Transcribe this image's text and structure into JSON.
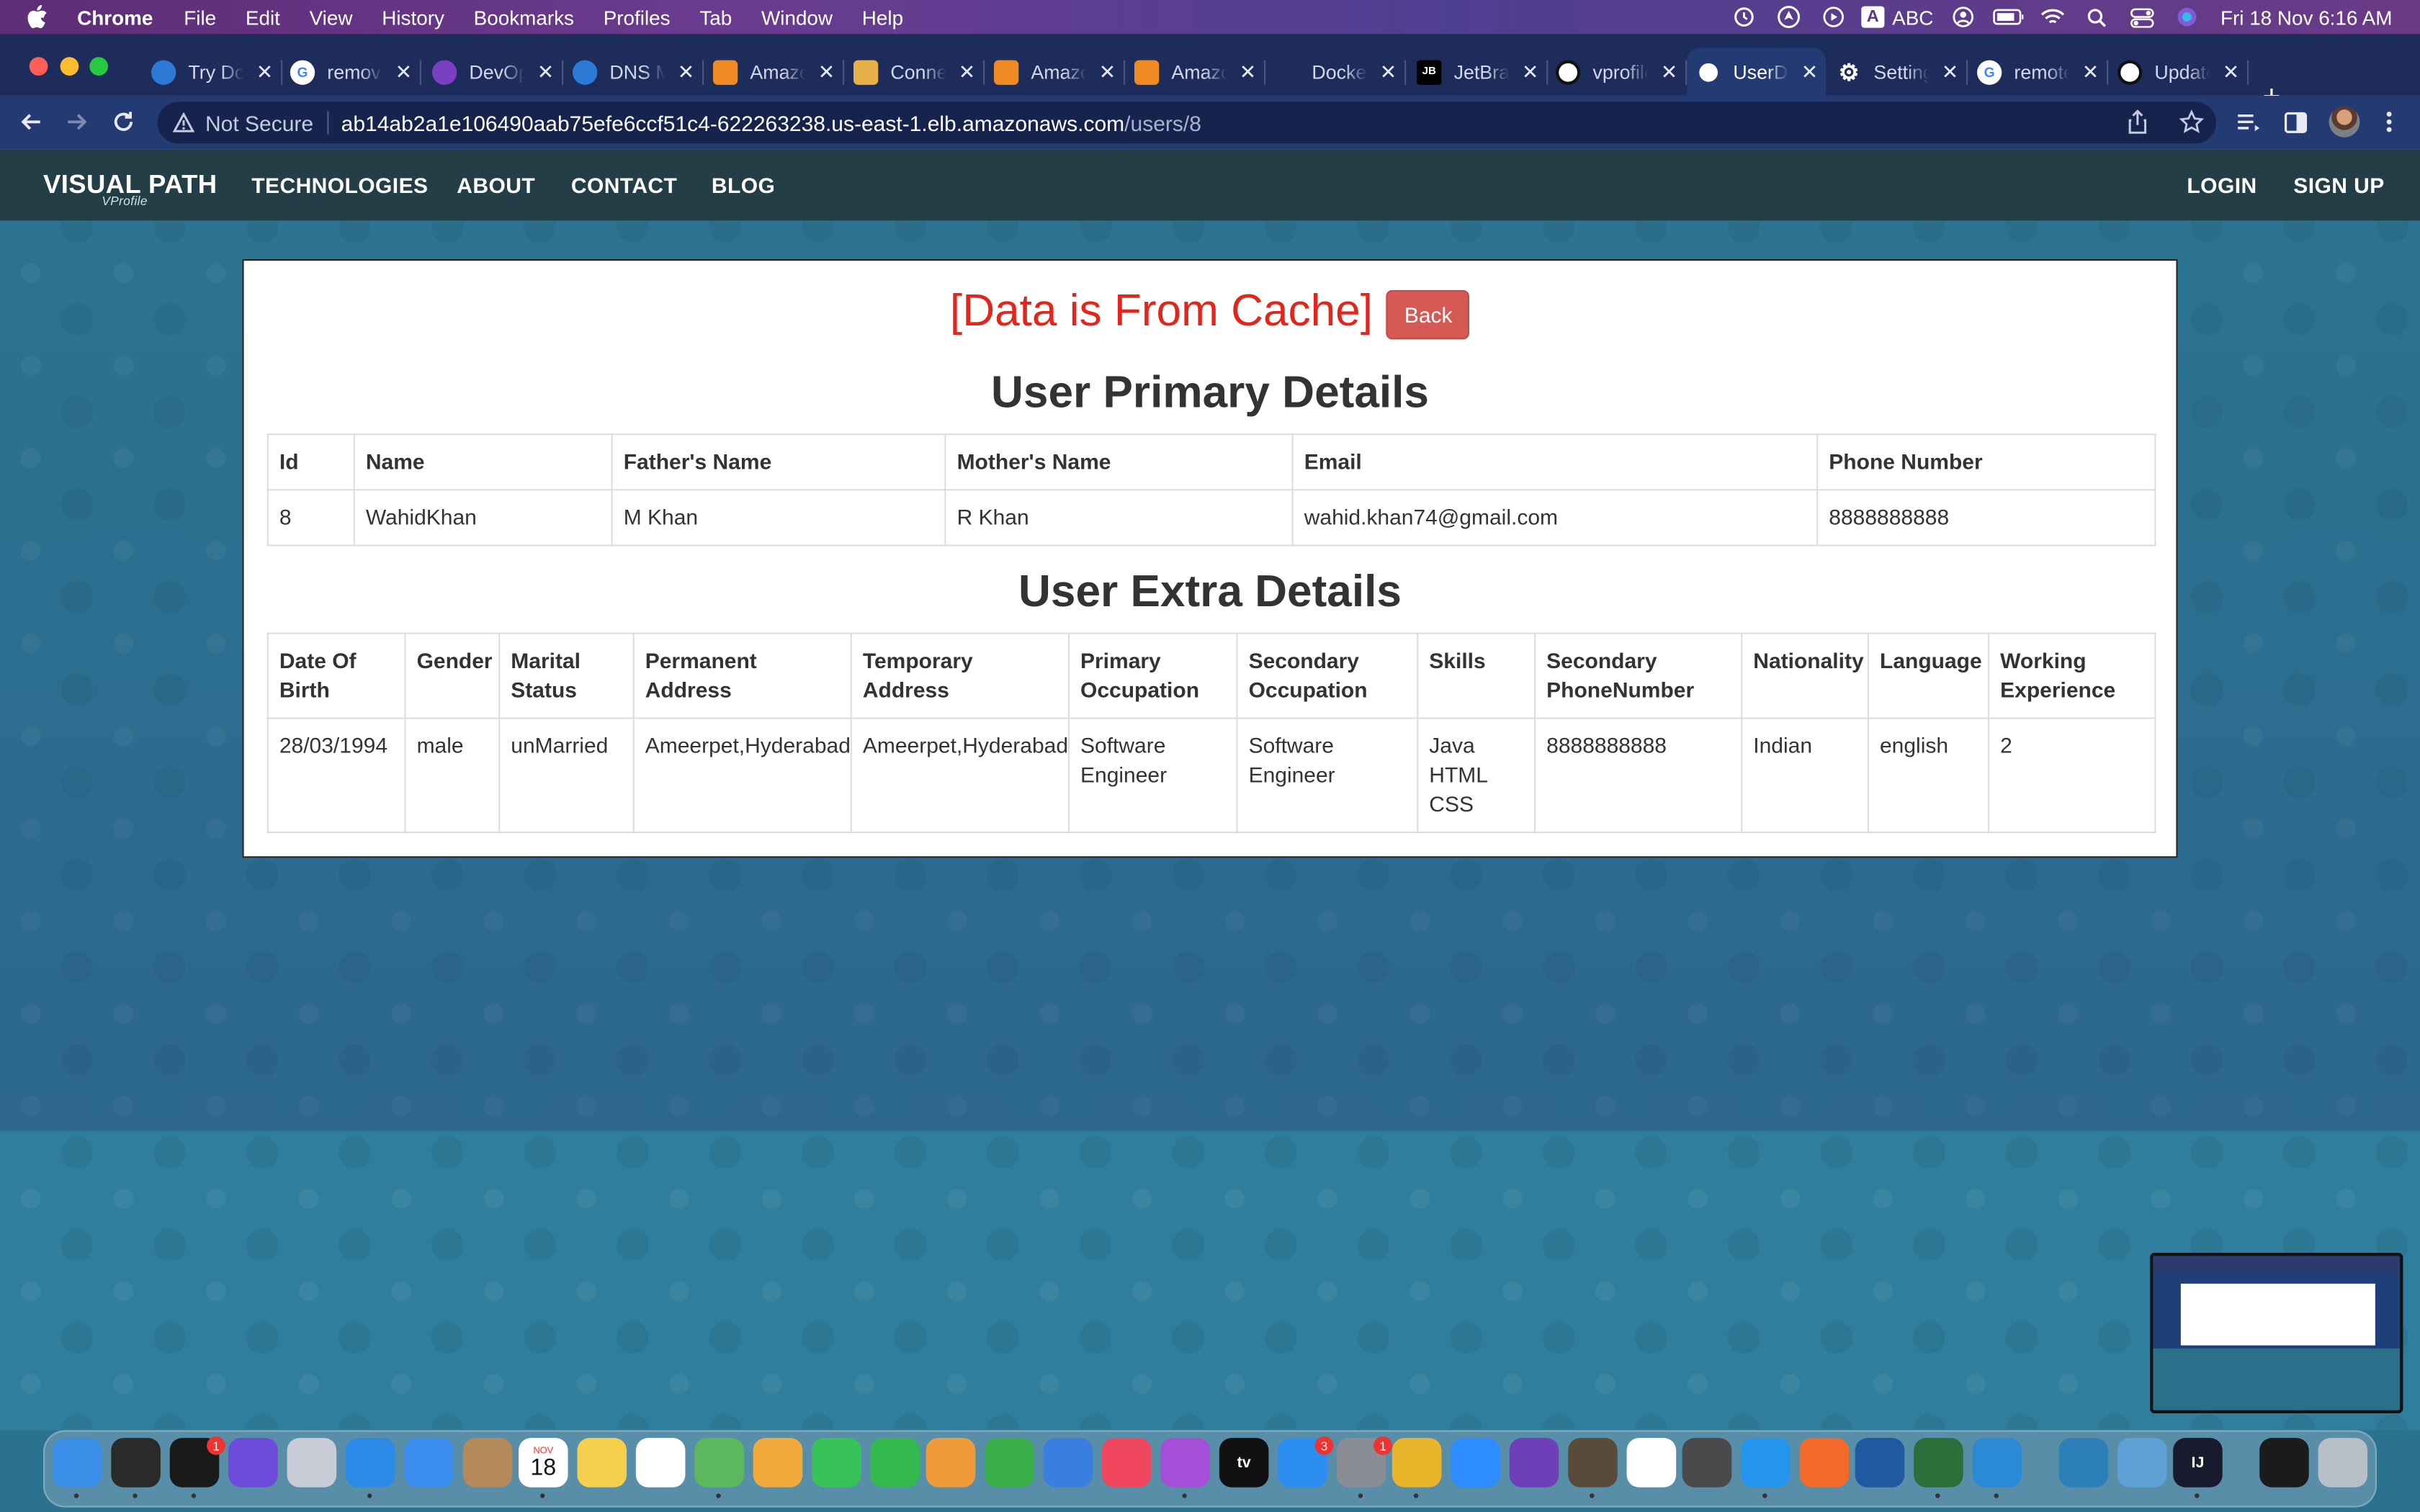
{
  "menubar": {
    "app": "Chrome",
    "items": [
      "File",
      "Edit",
      "View",
      "History",
      "Bookmarks",
      "Profiles",
      "Tab",
      "Window",
      "Help"
    ],
    "input_source": "ABC",
    "input_badge": "A",
    "clock": "Fri 18 Nov  6:16 AM"
  },
  "tabs": [
    {
      "title": "Try Do",
      "icon": "edge-icon",
      "color": "#2d79d6"
    },
    {
      "title": "remove",
      "icon": "google-icon",
      "color": "#ffffff"
    },
    {
      "title": "DevOps",
      "icon": "devops-icon",
      "color": "#7b3fc2"
    },
    {
      "title": "DNS Ma",
      "icon": "dns-icon",
      "color": "#2d79d6"
    },
    {
      "title": "Amazon",
      "icon": "aws-box-icon",
      "color": "#f08a24"
    },
    {
      "title": "Connect",
      "icon": "package-icon",
      "color": "#e8b04a"
    },
    {
      "title": "Amazon",
      "icon": "aws-box-icon",
      "color": "#f08a24"
    },
    {
      "title": "Amazon",
      "icon": "aws-box-icon",
      "color": "#f08a24"
    },
    {
      "title": "Docker",
      "icon": "docker-icon",
      "color": "#1d2c5a"
    },
    {
      "title": "JetBrains",
      "icon": "jetbrains-icon",
      "color": "#000000"
    },
    {
      "title": "vprofile",
      "icon": "github-icon",
      "color": "#ffffff"
    },
    {
      "title": "UserDetails",
      "icon": "globe-icon",
      "color": "#ffffff",
      "active": true
    },
    {
      "title": "Settings",
      "icon": "gear-icon",
      "color": "#ffffff"
    },
    {
      "title": "remote",
      "icon": "google-icon",
      "color": "#ffffff"
    },
    {
      "title": "Update",
      "icon": "github-icon",
      "color": "#ffffff"
    }
  ],
  "address": {
    "security": "Not Secure",
    "host": "ab14ab2a1e106490aab75efe6ccf51c4-622263238.us-east-1.elb.amazonaws.com",
    "path": "/users/8"
  },
  "site": {
    "brand": "VISUAL PATH",
    "brand_sub": "VProfile",
    "nav": [
      "TECHNOLOGIES",
      "ABOUT",
      "CONTACT",
      "BLOG"
    ],
    "login": "LOGIN",
    "signup": "SIGN UP"
  },
  "card": {
    "cache_title": "[Data is From Cache]",
    "back_label": "Back",
    "primary_heading": "User Primary Details",
    "extra_heading": "User Extra Details"
  },
  "primary_table": {
    "headers": [
      "Id",
      "Name",
      "Father's Name",
      "Mother's Name",
      "Email",
      "Phone Number"
    ],
    "rows": [
      [
        "8",
        "WahidKhan",
        "M Khan",
        "R Khan",
        "wahid.khan74@gmail.com",
        "8888888888"
      ]
    ]
  },
  "extra_table": {
    "headers": [
      "Date Of Birth",
      "Gender",
      "Marital Status",
      "Permanent Address",
      "Temporary Address",
      "Primary Occupation",
      "Secondary Occupation",
      "Skills",
      "Secondary PhoneNumber",
      "Nationality",
      "Language",
      "Working Experience"
    ],
    "rows": [
      [
        "28/03/1994",
        "male",
        "unMarried",
        "Ameerpet,Hyderabad",
        "Ameerpet,Hyderabad",
        "Software Engineer",
        "Software Engineer",
        "Java HTML CSS",
        "8888888888",
        "Indian",
        "english",
        "2"
      ]
    ]
  },
  "dock": {
    "apps": [
      {
        "name": "finder-icon",
        "color": "#3b8ee8"
      },
      {
        "name": "activity-monitor-icon",
        "color": "#2a2a2a"
      },
      {
        "name": "terminal-icon",
        "color": "#1a1a1a",
        "badge": "1"
      },
      {
        "name": "siri-icon",
        "color": "#6c4bd8"
      },
      {
        "name": "launchpad-icon",
        "color": "#c8ccd6"
      },
      {
        "name": "safari-icon",
        "color": "#2b8be6"
      },
      {
        "name": "mail-icon",
        "color": "#3c8ff0"
      },
      {
        "name": "contacts-icon",
        "color": "#b48a5a"
      },
      {
        "name": "calendar-icon",
        "color": "#ffffff",
        "label_top": "NOV",
        "label": "18"
      },
      {
        "name": "notes-icon",
        "color": "#f5d04c"
      },
      {
        "name": "reminders-icon",
        "color": "#ffffff"
      },
      {
        "name": "maps-icon",
        "color": "#5bb85c"
      },
      {
        "name": "photos-icon",
        "color": "#f2a93b"
      },
      {
        "name": "messages-icon",
        "color": "#37c25a"
      },
      {
        "name": "facetime-icon",
        "color": "#34b94f"
      },
      {
        "name": "pages-icon",
        "color": "#f19a3a"
      },
      {
        "name": "numbers-icon",
        "color": "#3ab04a"
      },
      {
        "name": "keynote-icon",
        "color": "#3a7fe0"
      },
      {
        "name": "music-icon",
        "color": "#f0475e"
      },
      {
        "name": "podcasts-icon",
        "color": "#a54ed8"
      },
      {
        "name": "apple-tv-icon",
        "color": "#111111",
        "label": "tv"
      },
      {
        "name": "app-store-icon",
        "color": "#2c8ef0",
        "badge": "3"
      },
      {
        "name": "system-preferences-icon",
        "color": "#8a8d95",
        "badge": "1"
      },
      {
        "name": "chrome-icon",
        "color": "#e9b52a"
      },
      {
        "name": "zoom-icon",
        "color": "#2d8cff"
      },
      {
        "name": "github-desktop-icon",
        "color": "#6e3fb8"
      },
      {
        "name": "dbeaver-icon",
        "color": "#5a4a3a"
      },
      {
        "name": "intellij-bracket-icon",
        "color": "#ffffff"
      },
      {
        "name": "sequel-ace-icon",
        "color": "#4a4a4a"
      },
      {
        "name": "docker-icon",
        "color": "#2496ed"
      },
      {
        "name": "postman-icon",
        "color": "#f46a2a"
      },
      {
        "name": "virtualbox-icon",
        "color": "#1f5aa0"
      },
      {
        "name": "loading-ring-icon",
        "color": "#2d6f3a"
      },
      {
        "name": "vscode-icon",
        "color": "#2a8ad6"
      },
      {
        "name": "mountain-icon",
        "color": "#2c7fb8"
      },
      {
        "name": "preview-icon",
        "color": "#5fa0d6"
      },
      {
        "name": "intellij-icon",
        "color": "#1a1a2e",
        "label": "IJ"
      },
      {
        "name": "screenshot-icon",
        "color": "#1b1b1b"
      },
      {
        "name": "trash-icon",
        "color": "#b9bfc8"
      }
    ]
  }
}
